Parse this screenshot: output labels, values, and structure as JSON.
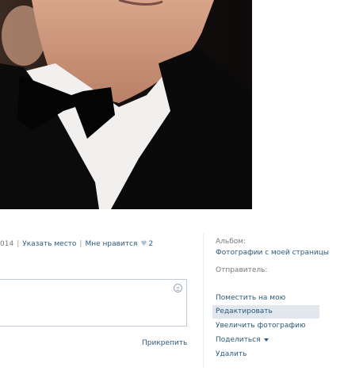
{
  "photo_actions": {
    "date_fragment": "014",
    "mark_place": "Указать место",
    "like_label": "Мне нравится",
    "like_count": "2"
  },
  "comment": {
    "attach_label": "Прикрепить"
  },
  "sidebar": {
    "album_label": "Альбом:",
    "album_link": "Фотографии с моей страницы",
    "sender_label": "Отправитель:",
    "menu": [
      {
        "label": "Поместить на мою страницу"
      },
      {
        "label": "Редактировать"
      },
      {
        "label": "Увеличить фотографию"
      },
      {
        "label": "Поделиться"
      },
      {
        "label": "Удалить"
      }
    ]
  },
  "icons": {
    "like": "heart-icon",
    "emoji": "smile-icon",
    "dropdown": "chevron-down-icon"
  }
}
